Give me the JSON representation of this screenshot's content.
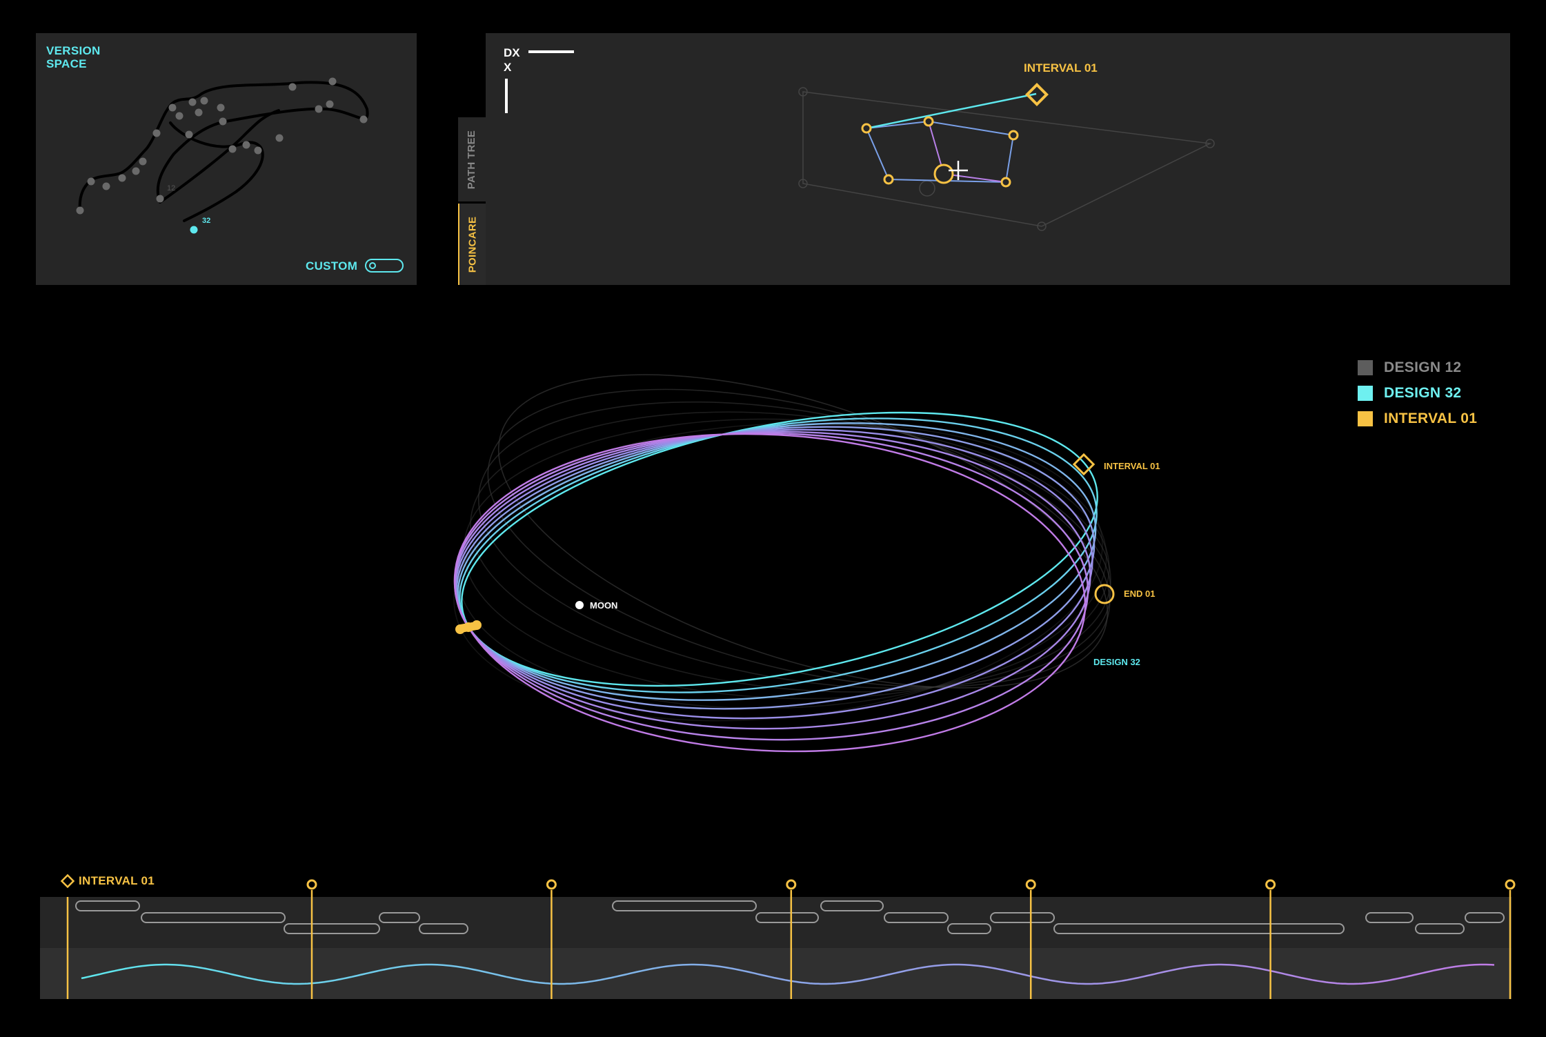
{
  "version_space": {
    "title": "VERSION\nSPACE",
    "node_label_12": "12",
    "node_label_32": "32",
    "custom_label": "CUSTOM",
    "custom_toggle_on": false
  },
  "tabs": [
    {
      "label": "PATH TREE",
      "active": false
    },
    {
      "label": "POINCARE",
      "active": true
    }
  ],
  "poincare": {
    "axis_dx": "DX",
    "axis_x": "X",
    "interval_label": "INTERVAL 01"
  },
  "orbit": {
    "moon_label": "MOON",
    "interval_label": "INTERVAL 01",
    "end_label": "END 01",
    "design_label": "DESIGN 32"
  },
  "legend": [
    {
      "label": "DESIGN 12",
      "color": "#5d5d5d"
    },
    {
      "label": "DESIGN 32",
      "color": "#6ef0f0"
    },
    {
      "label": "INTERVAL 01",
      "color": "#f7c244"
    }
  ],
  "timeline": {
    "title": "INTERVAL 01",
    "markers": 6
  },
  "colors": {
    "accent_cyan": "#5ee8ee",
    "accent_yellow": "#f7c244",
    "accent_purple": "#c07be6",
    "panel_bg": "#262626"
  }
}
